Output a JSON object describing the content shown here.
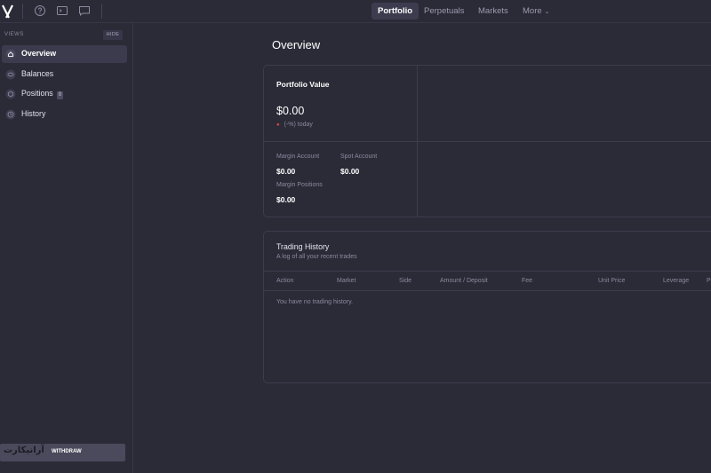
{
  "topbar": {
    "nav": [
      "Portfolio",
      "Perpetuals",
      "Markets",
      "More"
    ]
  },
  "sidebar": {
    "views_label": "VIEWS",
    "hide_label": "HIDE",
    "items": [
      {
        "label": "Overview",
        "icon": "home-icon",
        "active": true
      },
      {
        "label": "Balances",
        "icon": "coins-icon"
      },
      {
        "label": "Positions",
        "icon": "cube-icon",
        "badge": "0"
      },
      {
        "label": "History",
        "icon": "clock-icon"
      }
    ],
    "watermark": "آرانیکارت",
    "watermark_small": "WITHDRAW"
  },
  "main": {
    "title": "Overview",
    "portfolio": {
      "title": "Portfolio Value",
      "value": "$0.00",
      "change": "(-%) today",
      "margin_account_label": "Margin Account",
      "margin_account_value": "$0.00",
      "spot_account_label": "Spot Account",
      "spot_account_value": "$0.00",
      "margin_positions_label": "Margin Positions",
      "margin_positions_value": "$0.00"
    },
    "trading_history": {
      "title": "Trading History",
      "subtitle": "A log of all your recent trades",
      "columns": [
        "Action",
        "Market",
        "Side",
        "Amount / Deposit",
        "Fee",
        "Unit Price",
        "Leverage",
        "P"
      ],
      "empty": "You have no trading history."
    }
  },
  "colors": {
    "background": "#2b2a37",
    "border": "#3d3c4d",
    "negative": "#e5484d"
  }
}
